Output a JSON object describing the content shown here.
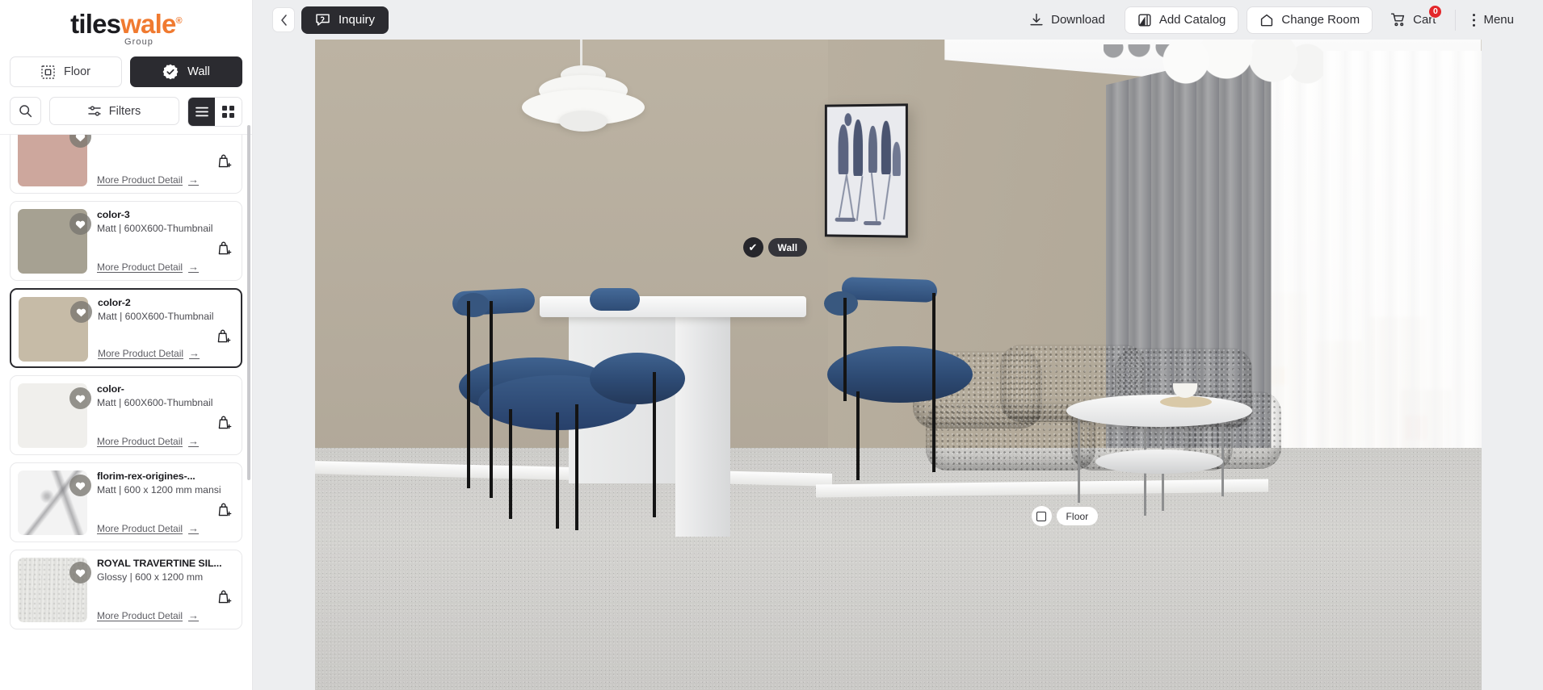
{
  "brand": {
    "name_part1": "tiles",
    "name_part2": "wale",
    "registered": "®",
    "subtitle": "Group"
  },
  "sidebar": {
    "modes": [
      {
        "label": "Floor",
        "icon": "floor-grid-icon",
        "active": false
      },
      {
        "label": "Wall",
        "icon": "check-badge-icon",
        "active": true
      }
    ],
    "controls": {
      "search_icon": "search-icon",
      "filters_label": "Filters",
      "filters_icon": "sliders-icon",
      "view_list_icon": "list-view-icon",
      "view_grid_icon": "grid-view-icon",
      "active_view": "list"
    },
    "more_detail_label": "More Product Detail",
    "more_detail_arrow": "→",
    "favorite_icon": "heart-icon",
    "add_to_cart_icon": "shopping-bag-plus-icon",
    "products": [
      {
        "title": "",
        "meta": "",
        "swatch": "#cda79d",
        "partial": true,
        "selected": false
      },
      {
        "title": "color-3",
        "meta": "Matt | 600X600-Thumbnail",
        "swatch": "#a6a192",
        "partial": false,
        "selected": false
      },
      {
        "title": "color-2",
        "meta": "Matt | 600X600-Thumbnail",
        "swatch": "#c6bba7",
        "partial": false,
        "selected": true
      },
      {
        "title": "color-",
        "meta": "Matt | 600X600-Thumbnail",
        "swatch": "#f0efec",
        "partial": false,
        "selected": false
      },
      {
        "title": "florim-rex-origines-...",
        "meta": "Matt | 600 x 1200 mm mansi",
        "swatch": "#f3f3f3",
        "partial": false,
        "selected": false
      },
      {
        "title": "ROYAL TRAVERTINE SIL...",
        "meta": "Glossy | 600 x 1200 mm",
        "swatch": "#ededea",
        "partial": false,
        "selected": false
      }
    ]
  },
  "toolbar": {
    "back_icon": "chevron-left-icon",
    "inquiry_label": "Inquiry",
    "inquiry_icon": "chat-question-icon",
    "download_label": "Download",
    "download_icon": "download-icon",
    "add_catalog_label": "Add Catalog",
    "add_catalog_icon": "book-icon",
    "change_room_label": "Change Room",
    "change_room_icon": "home-icon",
    "cart_label": "Cart",
    "cart_icon": "cart-icon",
    "cart_count": "0",
    "menu_label": "Menu",
    "menu_icon": "kebab-menu-icon"
  },
  "scene": {
    "wall_marker": {
      "label": "Wall",
      "state_icon": "check-icon",
      "selected": true
    },
    "floor_marker": {
      "label": "Floor",
      "state_icon": "square-icon",
      "selected": false
    }
  },
  "colors": {
    "accent_orange": "#f07a30",
    "dark": "#2b2b30",
    "badge_red": "#e3262a",
    "wall_beige": "#b2a999",
    "floor_grey": "#cfcecb",
    "chair_blue": "#2d4a73",
    "sofa_grey": "#55565a"
  }
}
